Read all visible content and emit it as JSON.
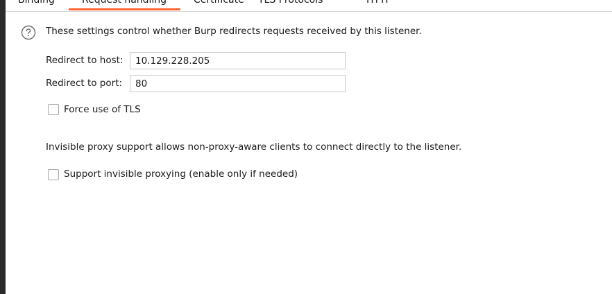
{
  "tabs": [
    {
      "label": "Binding"
    },
    {
      "label": "Request handling"
    },
    {
      "label": "Certificate"
    },
    {
      "label": "TLS Protocols"
    },
    {
      "label": "HTTP"
    }
  ],
  "active_tab": "Request handling",
  "accent_color": "#ff6633",
  "icons": {
    "help": "help-circle-icon"
  },
  "redirect": {
    "description": "These settings control whether Burp redirects requests received by this listener.",
    "host_label": "Redirect to host:",
    "host_value": "10.129.228.205",
    "port_label": "Redirect to port:",
    "port_value": "80",
    "force_tls_label": "Force use of TLS",
    "force_tls_checked": false
  },
  "invisible": {
    "description": "Invisible proxy support allows non-proxy-aware clients to connect directly to the listener.",
    "support_label": "Support invisible proxying (enable only if needed)",
    "support_checked": false
  }
}
